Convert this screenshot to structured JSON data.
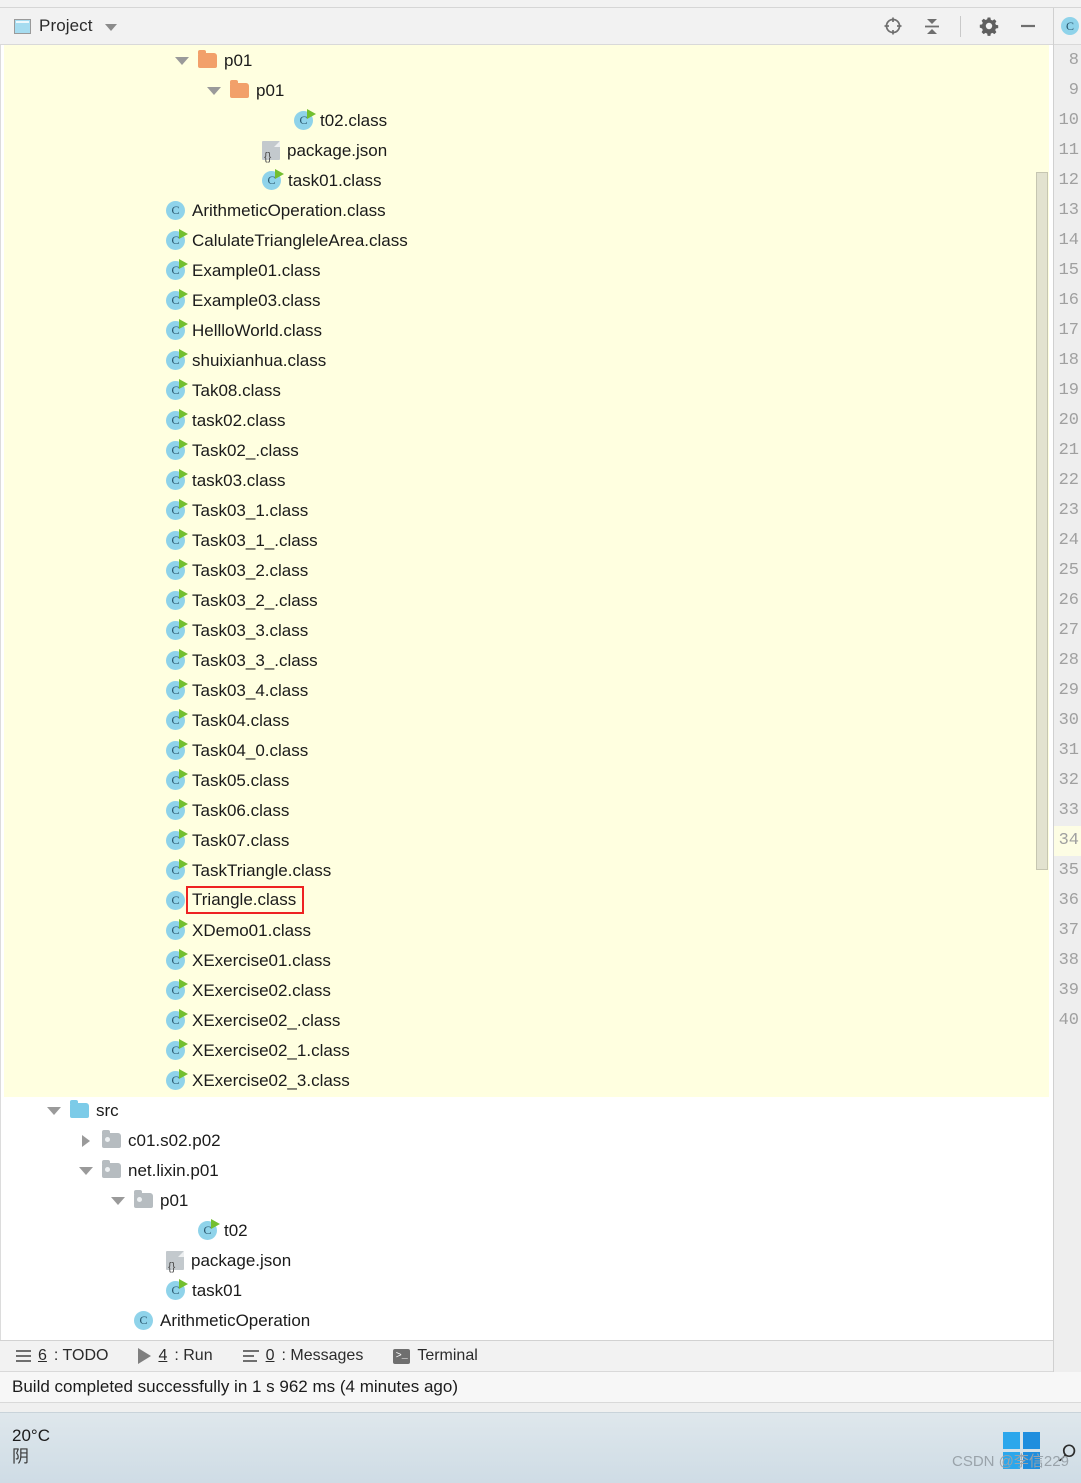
{
  "toolwindow": {
    "title": "Project",
    "icon": "project-icon",
    "dropdown_icon": "chevron-down-icon",
    "actions": [
      {
        "name": "locate-in-tree-icon",
        "label": ""
      },
      {
        "name": "collapse-all-icon",
        "label": ""
      },
      {
        "name": "settings-gear-icon",
        "label": ""
      },
      {
        "name": "minimize-icon",
        "label": ""
      }
    ]
  },
  "tree": {
    "rows": [
      {
        "depth": 5,
        "twisty": "open",
        "icon": "folder-orange",
        "label": "p01"
      },
      {
        "depth": 6,
        "twisty": "open",
        "icon": "folder-orange",
        "label": "p01"
      },
      {
        "depth": 8,
        "twisty": "none",
        "icon": "class-runnable",
        "label": "t02.class"
      },
      {
        "depth": 7,
        "twisty": "none",
        "icon": "json",
        "label": "package.json"
      },
      {
        "depth": 7,
        "twisty": "none",
        "icon": "class-runnable",
        "label": "task01.class"
      },
      {
        "depth": 4,
        "twisty": "none",
        "icon": "class",
        "label": "ArithmeticOperation.class"
      },
      {
        "depth": 4,
        "twisty": "none",
        "icon": "class-runnable",
        "label": "CalulateTriangleleArea.class"
      },
      {
        "depth": 4,
        "twisty": "none",
        "icon": "class-runnable",
        "label": "Example01.class"
      },
      {
        "depth": 4,
        "twisty": "none",
        "icon": "class-runnable",
        "label": "Example03.class"
      },
      {
        "depth": 4,
        "twisty": "none",
        "icon": "class-runnable",
        "label": "HellloWorld.class"
      },
      {
        "depth": 4,
        "twisty": "none",
        "icon": "class-runnable",
        "label": "shuixianhua.class"
      },
      {
        "depth": 4,
        "twisty": "none",
        "icon": "class-runnable",
        "label": "Tak08.class"
      },
      {
        "depth": 4,
        "twisty": "none",
        "icon": "class-runnable",
        "label": "task02.class"
      },
      {
        "depth": 4,
        "twisty": "none",
        "icon": "class-runnable",
        "label": "Task02_.class"
      },
      {
        "depth": 4,
        "twisty": "none",
        "icon": "class-runnable",
        "label": "task03.class"
      },
      {
        "depth": 4,
        "twisty": "none",
        "icon": "class-runnable",
        "label": "Task03_1.class"
      },
      {
        "depth": 4,
        "twisty": "none",
        "icon": "class-runnable",
        "label": "Task03_1_.class"
      },
      {
        "depth": 4,
        "twisty": "none",
        "icon": "class-runnable",
        "label": "Task03_2.class"
      },
      {
        "depth": 4,
        "twisty": "none",
        "icon": "class-runnable",
        "label": "Task03_2_.class"
      },
      {
        "depth": 4,
        "twisty": "none",
        "icon": "class-runnable",
        "label": "Task03_3.class"
      },
      {
        "depth": 4,
        "twisty": "none",
        "icon": "class-runnable",
        "label": "Task03_3_.class"
      },
      {
        "depth": 4,
        "twisty": "none",
        "icon": "class-runnable",
        "label": "Task03_4.class"
      },
      {
        "depth": 4,
        "twisty": "none",
        "icon": "class-runnable",
        "label": "Task04.class"
      },
      {
        "depth": 4,
        "twisty": "none",
        "icon": "class-runnable",
        "label": "Task04_0.class"
      },
      {
        "depth": 4,
        "twisty": "none",
        "icon": "class-runnable",
        "label": "Task05.class"
      },
      {
        "depth": 4,
        "twisty": "none",
        "icon": "class-runnable",
        "label": "Task06.class"
      },
      {
        "depth": 4,
        "twisty": "none",
        "icon": "class-runnable",
        "label": "Task07.class"
      },
      {
        "depth": 4,
        "twisty": "none",
        "icon": "class-runnable",
        "label": "TaskTriangle.class"
      },
      {
        "depth": 4,
        "twisty": "none",
        "icon": "class",
        "label": "Triangle.class",
        "selected": true
      },
      {
        "depth": 4,
        "twisty": "none",
        "icon": "class-runnable",
        "label": "XDemo01.class"
      },
      {
        "depth": 4,
        "twisty": "none",
        "icon": "class-runnable",
        "label": "XExercise01.class"
      },
      {
        "depth": 4,
        "twisty": "none",
        "icon": "class-runnable",
        "label": "XExercise02.class"
      },
      {
        "depth": 4,
        "twisty": "none",
        "icon": "class-runnable",
        "label": "XExercise02_.class"
      },
      {
        "depth": 4,
        "twisty": "none",
        "icon": "class-runnable",
        "label": "XExercise02_1.class"
      },
      {
        "depth": 4,
        "twisty": "none",
        "icon": "class-runnable",
        "label": "XExercise02_3.class"
      },
      {
        "depth": 1,
        "twisty": "open",
        "icon": "folder-blue",
        "label": "src"
      },
      {
        "depth": 2,
        "twisty": "closed",
        "icon": "package",
        "label": "c01.s02.p02"
      },
      {
        "depth": 2,
        "twisty": "open",
        "icon": "package",
        "label": "net.lixin.p01"
      },
      {
        "depth": 3,
        "twisty": "open",
        "icon": "package",
        "label": "p01"
      },
      {
        "depth": 5,
        "twisty": "none",
        "icon": "class-runnable",
        "label": "t02"
      },
      {
        "depth": 4,
        "twisty": "none",
        "icon": "json",
        "label": "package.json"
      },
      {
        "depth": 4,
        "twisty": "none",
        "icon": "class-runnable",
        "label": "task01"
      },
      {
        "depth": 3,
        "twisty": "none",
        "icon": "class",
        "label": "ArithmeticOperation"
      }
    ]
  },
  "gutter": {
    "line_numbers": [
      8,
      9,
      10,
      11,
      12,
      13,
      14,
      15,
      16,
      17,
      18,
      19,
      20,
      21,
      22,
      23,
      24,
      25,
      26,
      27,
      28,
      29,
      30,
      31,
      32,
      33,
      34,
      35,
      36,
      37,
      38,
      39,
      40
    ],
    "highlighted_line": 34
  },
  "bottom_bar": {
    "items": [
      {
        "icon": "todo-list-icon",
        "mnemonic": "6",
        "label": ": TODO"
      },
      {
        "icon": "run-play-icon",
        "mnemonic": "4",
        "label": ": Run"
      },
      {
        "icon": "messages-icon",
        "mnemonic": "0",
        "label": ": Messages"
      },
      {
        "icon": "terminal-icon",
        "mnemonic": "",
        "label": "Terminal"
      }
    ]
  },
  "status_bar": {
    "message": "Build completed successfully in 1 s 962 ms (4 minutes ago)"
  },
  "taskbar": {
    "weather": {
      "temperature": "20°C",
      "condition": "阴"
    },
    "start_icon": "windows-logo-icon",
    "search_icon": "search-icon",
    "watermark": "CSDN @李信229"
  },
  "colors": {
    "panel_highlight": "#ffffe0",
    "selection_outline": "#ee2222",
    "folder_orange": "#f2a06a",
    "folder_blue": "#7ccbe8",
    "class_icon": "#8fd3ea",
    "run_arrow": "#73bf2f"
  }
}
